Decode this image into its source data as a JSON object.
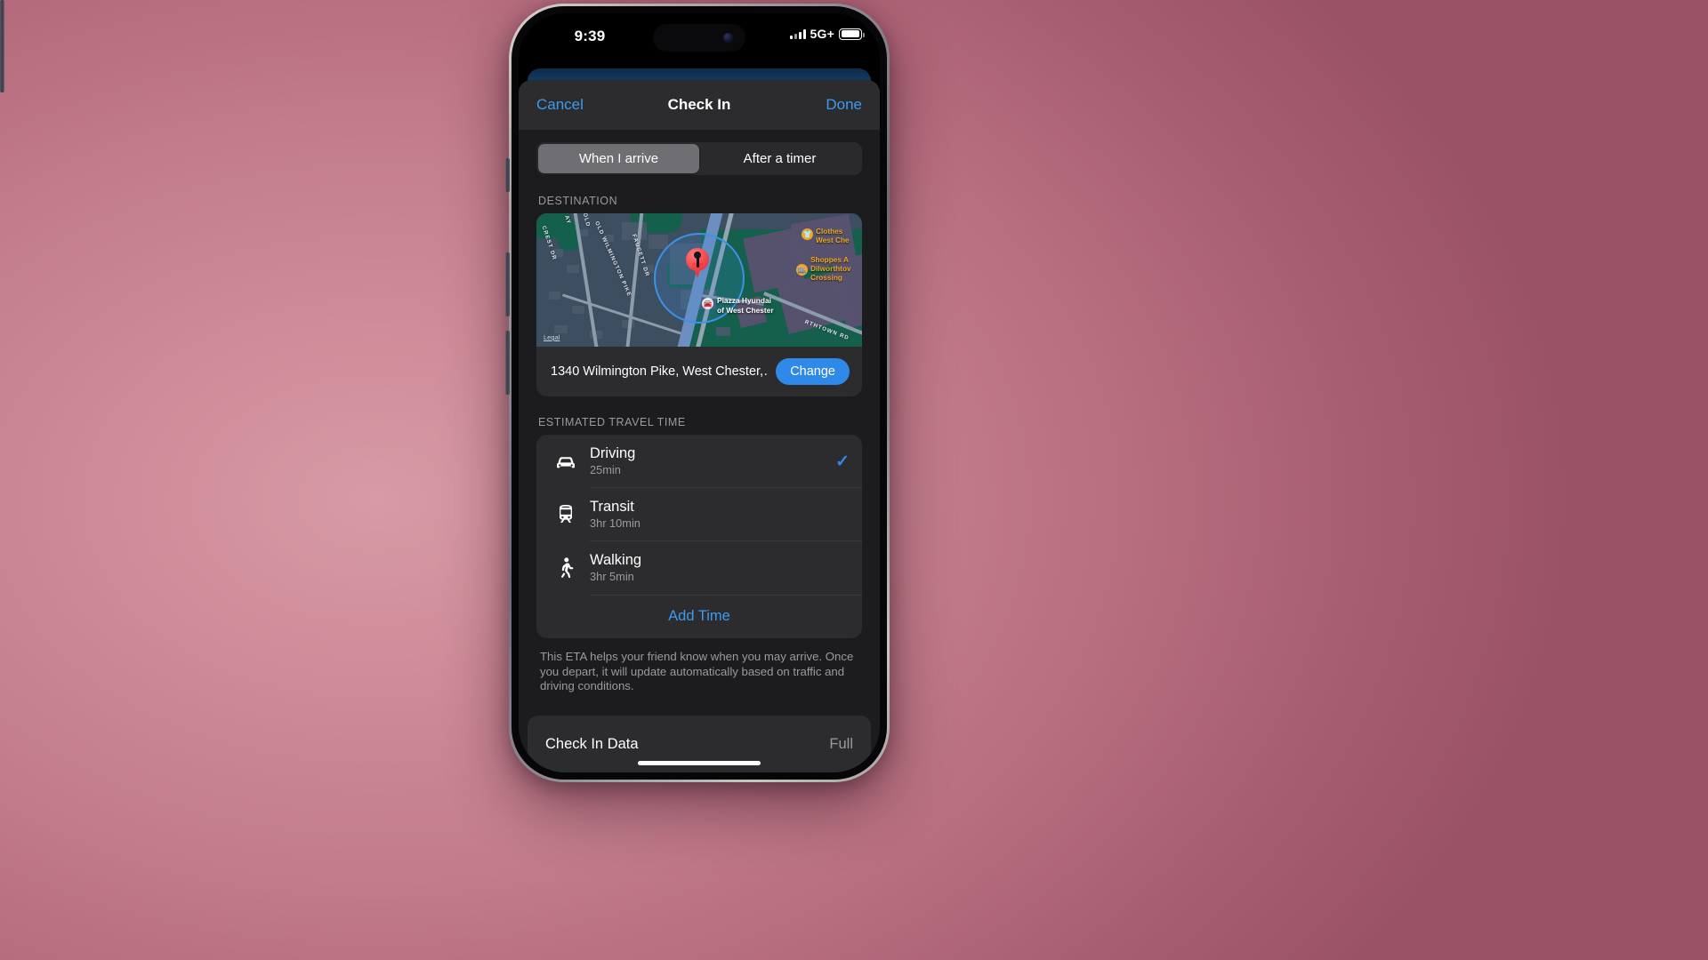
{
  "status_bar": {
    "time": "9:39",
    "network": "5G+",
    "signal_icon": "cellular-bars-icon",
    "battery_icon": "battery-full-icon",
    "battery_level": "full"
  },
  "nav": {
    "cancel_label": "Cancel",
    "title": "Check In",
    "done_label": "Done"
  },
  "segmented": {
    "options": [
      {
        "label": "When I arrive",
        "selected": true
      },
      {
        "label": "After a timer",
        "selected": false
      }
    ]
  },
  "destination": {
    "section_header": "DESTINATION",
    "address": "1340 Wilmington Pike, West Chester,…",
    "change_label": "Change",
    "map": {
      "legal_label": "Legal",
      "pin_icon": "map-pin-icon",
      "street_labels": [
        "CREST DR",
        "OLD WILMINGTON PIKE",
        "FAUCETT DR",
        "OLD",
        "AY",
        "RTHTOWN RD"
      ],
      "place_label": "Piazza Hyundai\nof West Chester",
      "place_line1": "Piazza Hyundai",
      "place_line2": "of West Chester",
      "pois": [
        {
          "line1": "Clothes",
          "line2": "West Che",
          "icon": "tshirt-icon"
        },
        {
          "line1": "Shoppes A",
          "line2": "Dilworthtov",
          "line3": "Crossing",
          "icon": "shop-icon"
        }
      ]
    }
  },
  "travel": {
    "section_header": "ESTIMATED TRAVEL TIME",
    "options": [
      {
        "name": "Driving",
        "duration": "25min",
        "icon": "car-icon",
        "selected": true
      },
      {
        "name": "Transit",
        "duration": "3hr 10min",
        "icon": "train-icon",
        "selected": false
      },
      {
        "name": "Walking",
        "duration": "3hr 5min",
        "icon": "walking-icon",
        "selected": false
      }
    ],
    "add_time_label": "Add Time",
    "check_icon": "checkmark-icon"
  },
  "footer_note": "This ETA helps your friend know when you may arrive. Once you depart, it will update automatically based on traffic and driving conditions.",
  "check_in_data": {
    "label": "Check In Data",
    "value": "Full"
  },
  "colors": {
    "accent_blue": "#3c9bf0",
    "button_blue": "#2f89e8",
    "sheet_bg": "#1c1c1e",
    "card_bg": "#2c2c2e",
    "poi_orange": "#f0a81e"
  }
}
